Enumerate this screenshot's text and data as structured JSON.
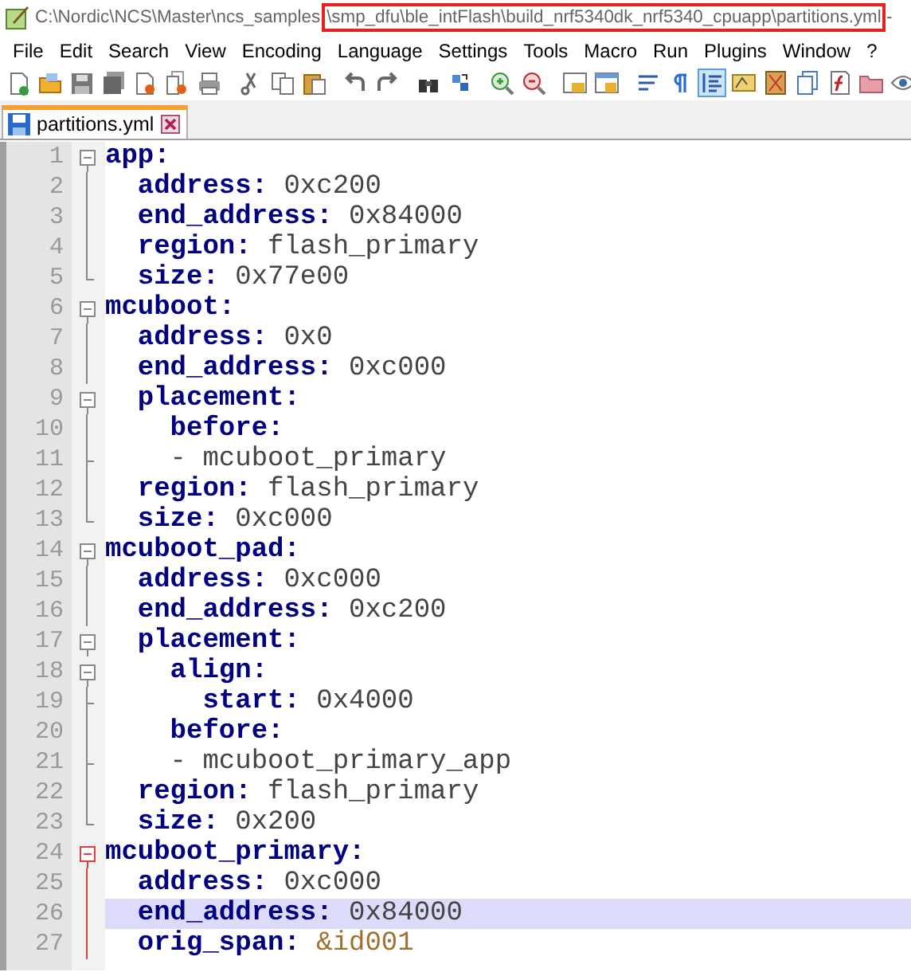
{
  "window": {
    "title_segments": [
      {
        "text": "C:\\Nordic\\NCS\\Master\\ncs_samples",
        "highlighted": false
      },
      {
        "text": "\\smp_dfu\\ble_intFlash\\build_nrf5340dk_nrf5340_cpuapp\\partitions.yml",
        "highlighted": true
      },
      {
        "text": " -",
        "highlighted": false
      }
    ]
  },
  "menu": [
    "File",
    "Edit",
    "Search",
    "View",
    "Encoding",
    "Language",
    "Settings",
    "Tools",
    "Macro",
    "Run",
    "Plugins",
    "Window",
    "?"
  ],
  "toolbar": [
    {
      "selected": false
    },
    {
      "selected": false
    },
    {
      "selected": false
    },
    {
      "selected": false
    },
    {
      "selected": false
    },
    {
      "selected": false
    },
    {
      "selected": false
    },
    {
      "selected": false
    },
    {
      "selected": false
    },
    {
      "selected": false
    },
    {
      "selected": false
    },
    {
      "selected": false
    },
    {
      "selected": false
    },
    {
      "selected": false
    },
    {
      "selected": false
    },
    {
      "selected": false
    },
    {
      "selected": false
    },
    {
      "selected": false
    },
    {
      "selected": false
    },
    {
      "selected": false
    },
    {
      "selected": true
    },
    {
      "selected": false
    },
    {
      "selected": false
    },
    {
      "selected": false
    },
    {
      "selected": false
    },
    {
      "selected": false
    },
    {
      "selected": false
    }
  ],
  "tabs": [
    {
      "label": "partitions.yml",
      "selected": true
    }
  ],
  "editor": {
    "lines": [
      {
        "number": "1",
        "fold": {
          "kind": "open",
          "active": false
        },
        "current": false,
        "parts": [
          {
            "kind": "key",
            "text": "app:"
          }
        ]
      },
      {
        "number": "2",
        "fold": {
          "kind": "line",
          "active": false
        },
        "current": false,
        "parts": [
          {
            "kind": "key",
            "text": "  address:"
          },
          {
            "kind": "scalar",
            "text": " 0xc200"
          }
        ]
      },
      {
        "number": "3",
        "fold": {
          "kind": "line",
          "active": false
        },
        "current": false,
        "parts": [
          {
            "kind": "key",
            "text": "  end_address:"
          },
          {
            "kind": "scalar",
            "text": " 0x84000"
          }
        ]
      },
      {
        "number": "4",
        "fold": {
          "kind": "line",
          "active": false
        },
        "current": false,
        "parts": [
          {
            "kind": "key",
            "text": "  region:"
          },
          {
            "kind": "scalar",
            "text": " flash_primary"
          }
        ]
      },
      {
        "number": "5",
        "fold": {
          "kind": "end",
          "active": false
        },
        "current": false,
        "parts": [
          {
            "kind": "key",
            "text": "  size:"
          },
          {
            "kind": "scalar",
            "text": " 0x77e00"
          }
        ]
      },
      {
        "number": "6",
        "fold": {
          "kind": "open",
          "active": false
        },
        "current": false,
        "parts": [
          {
            "kind": "key",
            "text": "mcuboot:"
          }
        ]
      },
      {
        "number": "7",
        "fold": {
          "kind": "line",
          "active": false
        },
        "current": false,
        "parts": [
          {
            "kind": "key",
            "text": "  address:"
          },
          {
            "kind": "scalar",
            "text": " 0x0"
          }
        ]
      },
      {
        "number": "8",
        "fold": {
          "kind": "line",
          "active": false
        },
        "current": false,
        "parts": [
          {
            "kind": "key",
            "text": "  end_address:"
          },
          {
            "kind": "scalar",
            "text": " 0xc000"
          }
        ]
      },
      {
        "number": "9",
        "fold": {
          "kind": "open",
          "active": false
        },
        "current": false,
        "parts": [
          {
            "kind": "key",
            "text": "  placement:"
          }
        ]
      },
      {
        "number": "10",
        "fold": {
          "kind": "line",
          "active": false
        },
        "current": false,
        "parts": [
          {
            "kind": "key",
            "text": "    before:"
          }
        ]
      },
      {
        "number": "11",
        "fold": {
          "kind": "tee",
          "active": false
        },
        "current": false,
        "parts": [
          {
            "kind": "item",
            "text": "    - mcuboot_primary"
          }
        ]
      },
      {
        "number": "12",
        "fold": {
          "kind": "line",
          "active": false
        },
        "current": false,
        "parts": [
          {
            "kind": "key",
            "text": "  region:"
          },
          {
            "kind": "scalar",
            "text": " flash_primary"
          }
        ]
      },
      {
        "number": "13",
        "fold": {
          "kind": "end",
          "active": false
        },
        "current": false,
        "parts": [
          {
            "kind": "key",
            "text": "  size:"
          },
          {
            "kind": "scalar",
            "text": " 0xc000"
          }
        ]
      },
      {
        "number": "14",
        "fold": {
          "kind": "open",
          "active": false
        },
        "current": false,
        "parts": [
          {
            "kind": "key",
            "text": "mcuboot_pad:"
          }
        ]
      },
      {
        "number": "15",
        "fold": {
          "kind": "line",
          "active": false
        },
        "current": false,
        "parts": [
          {
            "kind": "key",
            "text": "  address:"
          },
          {
            "kind": "scalar",
            "text": " 0xc000"
          }
        ]
      },
      {
        "number": "16",
        "fold": {
          "kind": "line",
          "active": false
        },
        "current": false,
        "parts": [
          {
            "kind": "key",
            "text": "  end_address:"
          },
          {
            "kind": "scalar",
            "text": " 0xc200"
          }
        ]
      },
      {
        "number": "17",
        "fold": {
          "kind": "open",
          "active": false
        },
        "current": false,
        "parts": [
          {
            "kind": "key",
            "text": "  placement:"
          }
        ]
      },
      {
        "number": "18",
        "fold": {
          "kind": "open",
          "active": false
        },
        "current": false,
        "parts": [
          {
            "kind": "key",
            "text": "    align:"
          }
        ]
      },
      {
        "number": "19",
        "fold": {
          "kind": "tee",
          "active": false
        },
        "current": false,
        "parts": [
          {
            "kind": "key",
            "text": "      start:"
          },
          {
            "kind": "scalar",
            "text": " 0x4000"
          }
        ]
      },
      {
        "number": "20",
        "fold": {
          "kind": "line",
          "active": false
        },
        "current": false,
        "parts": [
          {
            "kind": "key",
            "text": "    before:"
          }
        ]
      },
      {
        "number": "21",
        "fold": {
          "kind": "tee",
          "active": false
        },
        "current": false,
        "parts": [
          {
            "kind": "item",
            "text": "    - mcuboot_primary_app"
          }
        ]
      },
      {
        "number": "22",
        "fold": {
          "kind": "line",
          "active": false
        },
        "current": false,
        "parts": [
          {
            "kind": "key",
            "text": "  region:"
          },
          {
            "kind": "scalar",
            "text": " flash_primary"
          }
        ]
      },
      {
        "number": "23",
        "fold": {
          "kind": "end",
          "active": false
        },
        "current": false,
        "parts": [
          {
            "kind": "key",
            "text": "  size:"
          },
          {
            "kind": "scalar",
            "text": " 0x200"
          }
        ]
      },
      {
        "number": "24",
        "fold": {
          "kind": "open",
          "active": true
        },
        "current": false,
        "parts": [
          {
            "kind": "key",
            "text": "mcuboot_primary:"
          }
        ]
      },
      {
        "number": "25",
        "fold": {
          "kind": "line",
          "active": true
        },
        "current": false,
        "parts": [
          {
            "kind": "key",
            "text": "  address:"
          },
          {
            "kind": "scalar",
            "text": " 0xc000"
          }
        ]
      },
      {
        "number": "26",
        "fold": {
          "kind": "line",
          "active": true
        },
        "current": true,
        "parts": [
          {
            "kind": "key",
            "text": "  end_address:"
          },
          {
            "kind": "scalar",
            "text": " 0x84000"
          }
        ]
      },
      {
        "number": "27",
        "fold": {
          "kind": "line",
          "active": true
        },
        "current": false,
        "parts": [
          {
            "kind": "key",
            "text": "  orig_span:"
          },
          {
            "kind": "anchor",
            "text": " &id001"
          }
        ]
      }
    ]
  }
}
